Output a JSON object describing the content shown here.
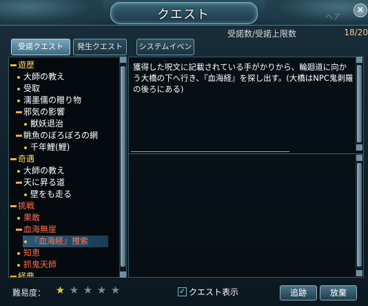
{
  "window": {
    "title": "クエスト",
    "ghost_tab": "ヘア",
    "close_glyph": "×"
  },
  "counter": {
    "label": "受諾数/受諾上限数",
    "value": "18/20"
  },
  "tabs": [
    {
      "label": "受諾クエスト",
      "active": true
    },
    {
      "label": "発生クエスト",
      "active": false
    },
    {
      "label": "システムイベント",
      "active": false
    }
  ],
  "quest_list": [
    {
      "label": "遊歴"
    },
    {
      "label": "大師の教え"
    },
    {
      "label": "受取"
    },
    {
      "label": "濡墨儒の贈り物"
    },
    {
      "label": "邪気の影響"
    },
    {
      "label": "獣妖退治"
    },
    {
      "label": "眺魚のぼろぼろの網"
    },
    {
      "label": "千年鯉(鯉)"
    },
    {
      "label": "奇遇"
    },
    {
      "label": "大師の教え"
    },
    {
      "label": "天に昇る道"
    },
    {
      "label": "壁をも走る"
    },
    {
      "label": "挑戦"
    },
    {
      "label": "果敢"
    },
    {
      "label": "血海無崖"
    },
    {
      "label": "『血海経』捜索"
    },
    {
      "label": "知恵"
    },
    {
      "label": "抓鬼天師"
    },
    {
      "label": "経典"
    }
  ],
  "description": "獲得した呪文に記載されている手がかりから、輪廻道に向かう大橋の下へ行き、『血海経』を探し出す。(大橋はNPC鬼剥羅の後ろにある)",
  "bottom": {
    "difficulty_label": "難易度：",
    "difficulty_stars": 1,
    "difficulty_max": 5,
    "show_quest_label": "クエスト表示",
    "show_quest_checked": true,
    "track_label": "追跡",
    "abandon_label": "放棄"
  },
  "colors": {
    "category": "#ffd76a",
    "leaf": "#ffffff",
    "active_quest": "#ff6a4a",
    "selected_bg": "#2a5a78",
    "accent": "#7aa7bc"
  },
  "icons": {
    "star": "★",
    "check": "✓"
  }
}
